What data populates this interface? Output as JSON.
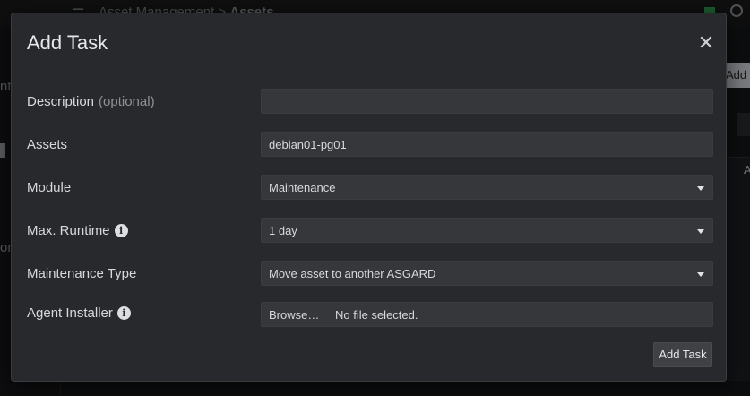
{
  "background": {
    "breadcrumb": {
      "parent": "Asset Management",
      "separator": ">",
      "current": "Assets"
    },
    "side_texts": [
      "nt",
      "on"
    ],
    "right_button": "Add S",
    "right_column_header": "A"
  },
  "modal": {
    "title": "Add Task",
    "close_label": "✕",
    "fields": {
      "description": {
        "label": "Description",
        "optional": "(optional)",
        "value": ""
      },
      "assets": {
        "label": "Assets",
        "value": "debian01-pg01"
      },
      "module": {
        "label": "Module",
        "value": "Maintenance"
      },
      "max_runtime": {
        "label": "Max. Runtime",
        "value": "1 day"
      },
      "maintenance_type": {
        "label": "Maintenance Type",
        "value": "Move asset to another ASGARD"
      },
      "agent_installer": {
        "label": "Agent Installer",
        "browse": "Browse…",
        "status": "No file selected."
      }
    },
    "submit_label": "Add Task"
  },
  "colors": {
    "modal_bg": "#28292d",
    "field_bg": "#35373b",
    "text": "#d7d9dc",
    "muted": "#8e9297"
  }
}
